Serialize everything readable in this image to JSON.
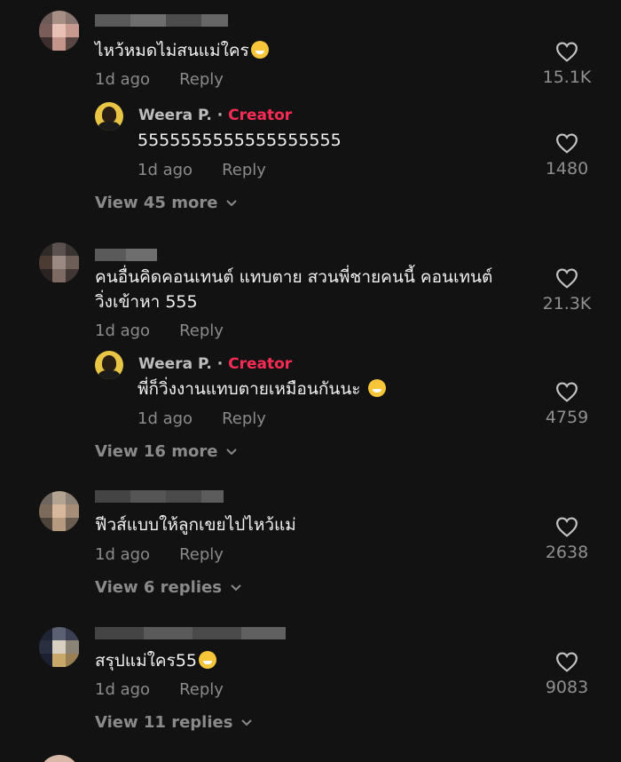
{
  "colors": {
    "background": "#121212",
    "text": "#f1f1f1",
    "muted": "#8a8a8a",
    "creator_badge": "#fe2c55"
  },
  "icons": {
    "like": "heart-outline-icon",
    "expand": "chevron-down-icon"
  },
  "comments": [
    {
      "text": "ไหว้หมดไม่สนแม่ใคร",
      "emoji": "grinning-face",
      "time": "1d ago",
      "reply_label": "Reply",
      "likes": "15.1K",
      "creator_reply": {
        "name": "Weera P.",
        "separator": "·",
        "badge": "Creator",
        "text": "5555555555555555555",
        "time": "1d ago",
        "reply_label": "Reply",
        "likes": "1480"
      },
      "view_more": "View 45 more"
    },
    {
      "text_line1": "คนอื่นคิดคอนเทนต์ แทบตาย สวนพี่ชายคนนี้ คอนเทนต์",
      "text_line2": "วิ่งเข้าหา 555",
      "time": "1d ago",
      "reply_label": "Reply",
      "likes": "21.3K",
      "creator_reply": {
        "name": "Weera P.",
        "separator": "·",
        "badge": "Creator",
        "text": "พี่ก็วิ่งงานแทบตายเหมือนกันนะ",
        "emoji": "face-with-tears-of-joy",
        "time": "1d ago",
        "reply_label": "Reply",
        "likes": "4759"
      },
      "view_more": "View 16 more"
    },
    {
      "text": "ฟีวส์แบบให้ลูกเขยไปไหว้แม่",
      "time": "1d ago",
      "reply_label": "Reply",
      "likes": "2638",
      "view_more": "View 6 replies"
    },
    {
      "text": "สรุปแม่ใคร55",
      "emoji": "rolling-on-floor-laughing",
      "time": "1d ago",
      "reply_label": "Reply",
      "likes": "9083",
      "view_more": "View 11 replies"
    }
  ]
}
